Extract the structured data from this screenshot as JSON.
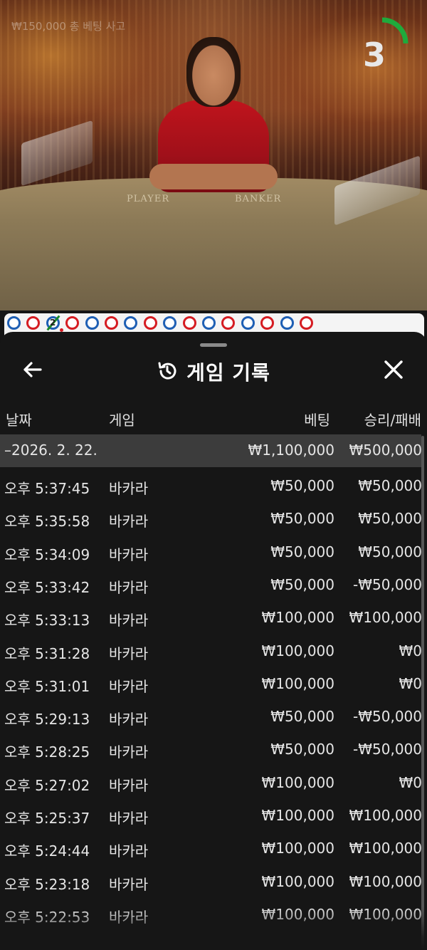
{
  "video": {
    "bet_overlay": "₩150,000  총 베팅 사고",
    "countdown": "3",
    "countdown_fraction": 0.25,
    "table_labels": {
      "player": "PLAYER",
      "banker": "BANKER"
    }
  },
  "road": {
    "marker": "2",
    "beads": [
      "player",
      "banker",
      "player",
      "banker",
      "player",
      "banker",
      "player",
      "banker",
      "player",
      "banker",
      "player",
      "banker",
      "player",
      "banker",
      "player",
      "banker"
    ]
  },
  "history": {
    "title": "게임 기록",
    "columns": {
      "date": "날짜",
      "game": "게임",
      "bet": "베팅",
      "result": "승리/패배"
    },
    "date_group": {
      "date": "–2026. 2. 22.",
      "bet_total": "₩1,100,000",
      "result_total": "₩500,000"
    },
    "rows": [
      {
        "time": "오후 5:37:45",
        "game": "바카라",
        "bet": "₩50,000",
        "result": "₩50,000"
      },
      {
        "time": "오후 5:35:58",
        "game": "바카라",
        "bet": "₩50,000",
        "result": "₩50,000"
      },
      {
        "time": "오후 5:34:09",
        "game": "바카라",
        "bet": "₩50,000",
        "result": "₩50,000"
      },
      {
        "time": "오후 5:33:42",
        "game": "바카라",
        "bet": "₩50,000",
        "result": "-₩50,000"
      },
      {
        "time": "오후 5:33:13",
        "game": "바카라",
        "bet": "₩100,000",
        "result": "₩100,000"
      },
      {
        "time": "오후 5:31:28",
        "game": "바카라",
        "bet": "₩100,000",
        "result": "₩0"
      },
      {
        "time": "오후 5:31:01",
        "game": "바카라",
        "bet": "₩100,000",
        "result": "₩0"
      },
      {
        "time": "오후 5:29:13",
        "game": "바카라",
        "bet": "₩50,000",
        "result": "-₩50,000"
      },
      {
        "time": "오후 5:28:25",
        "game": "바카라",
        "bet": "₩50,000",
        "result": "-₩50,000"
      },
      {
        "time": "오후 5:27:02",
        "game": "바카라",
        "bet": "₩100,000",
        "result": "₩0"
      },
      {
        "time": "오후 5:25:37",
        "game": "바카라",
        "bet": "₩100,000",
        "result": "₩100,000"
      },
      {
        "time": "오후 5:24:44",
        "game": "바카라",
        "bet": "₩100,000",
        "result": "₩100,000"
      },
      {
        "time": "오후 5:23:18",
        "game": "바카라",
        "bet": "₩100,000",
        "result": "₩100,000"
      },
      {
        "time": "오후 5:22:53",
        "game": "바카라",
        "bet": "₩100,000",
        "result": "₩100,000"
      }
    ]
  },
  "colors": {
    "player": "#1e5fb4",
    "banker": "#d51c22",
    "countdown_arc": "#1faa3c"
  },
  "icons": {
    "back": "arrow-left-icon",
    "history": "history-icon",
    "close": "close-icon"
  }
}
